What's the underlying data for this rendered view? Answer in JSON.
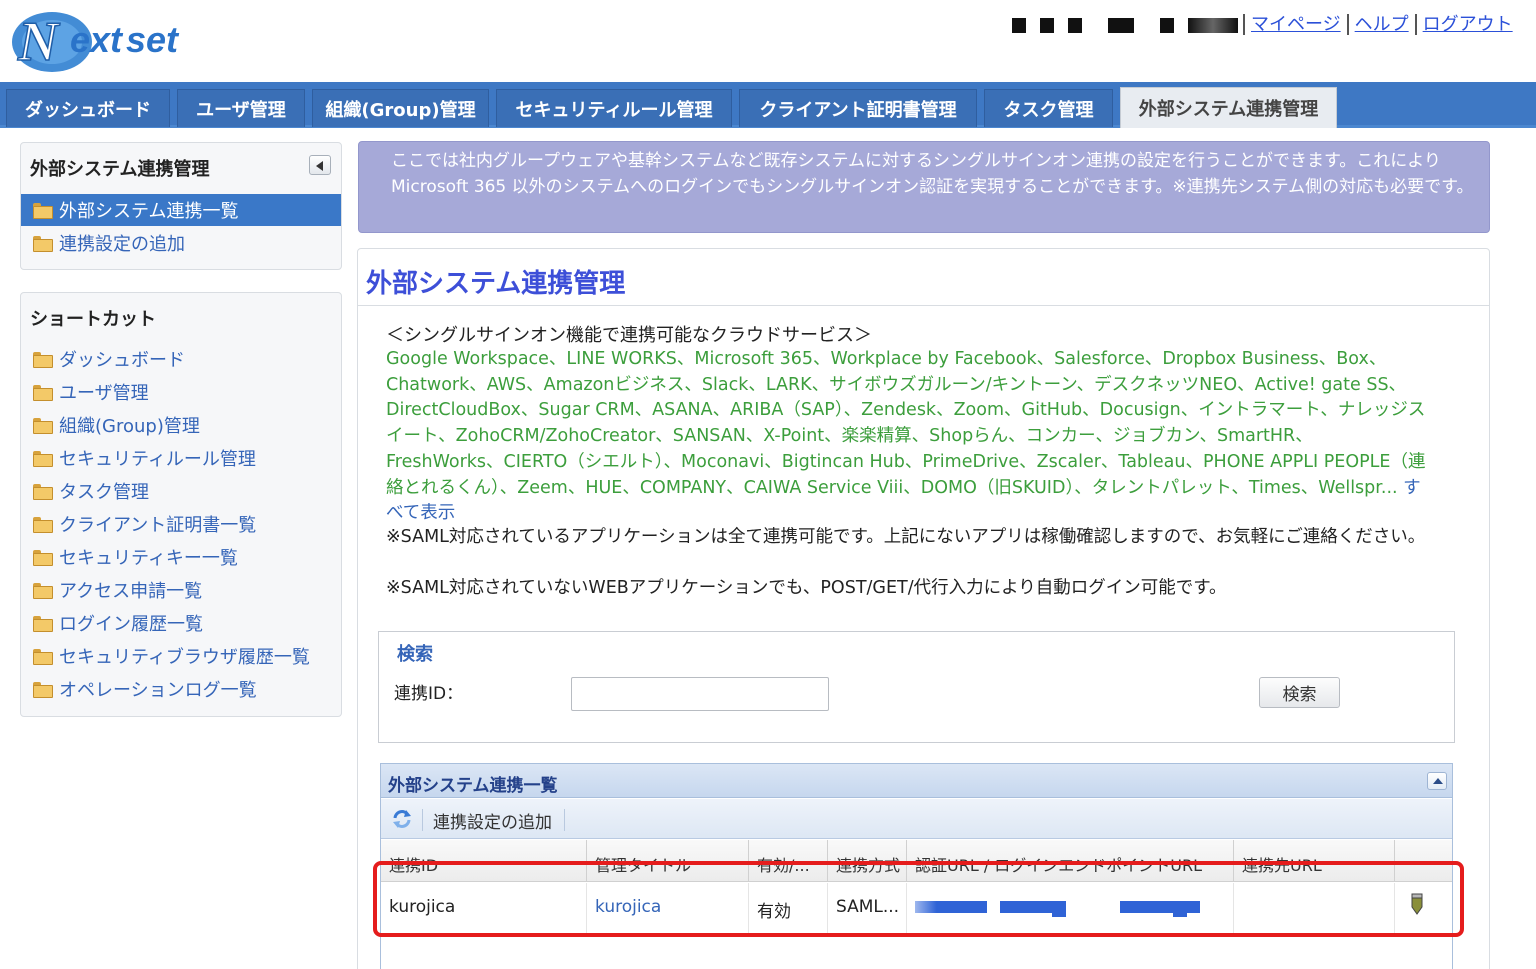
{
  "header": {
    "logo_text": "Nextset",
    "user_name_redacted": "■■■ ■■ ■ ■■■■",
    "links": [
      {
        "label": "マイページ"
      },
      {
        "label": "ヘルプ"
      },
      {
        "label": "ログアウト"
      }
    ]
  },
  "nav": {
    "tabs": [
      {
        "label": "ダッシュボード"
      },
      {
        "label": "ユーザ管理"
      },
      {
        "label": "組織(Group)管理"
      },
      {
        "label": "セキュリティルール管理"
      },
      {
        "label": "クライアント証明書管理"
      },
      {
        "label": "タスク管理"
      },
      {
        "label": "外部システム連携管理",
        "active": true
      }
    ]
  },
  "sidebar": {
    "section_title": "外部システム連携管理",
    "items": [
      {
        "label": "外部システム連携一覧",
        "selected": true
      },
      {
        "label": "連携設定の追加"
      }
    ],
    "shortcut_title": "ショートカット",
    "shortcuts": [
      {
        "label": "ダッシュボード"
      },
      {
        "label": "ユーザ管理"
      },
      {
        "label": "組織(Group)管理"
      },
      {
        "label": "セキュリティルール管理"
      },
      {
        "label": "タスク管理"
      },
      {
        "label": "クライアント証明書一覧"
      },
      {
        "label": "セキュリティキー一覧"
      },
      {
        "label": "アクセス申請一覧"
      },
      {
        "label": "ログイン履歴一覧"
      },
      {
        "label": "セキュリティブラウザ履歴一覧"
      },
      {
        "label": "オペレーションログ一覧"
      }
    ]
  },
  "info_banner": "ここでは社内グループウェアや基幹システムなど既存システムに対するシングルサインオン連携の設定を行うことができます。これによりMicrosoft 365 以外のシステムへのログインでもシングルサインオン認証を実現することができます。※連携先システム側の対応も必要です。",
  "main": {
    "title": "外部システム連携管理",
    "services_heading": "＜シングルサインオン機能で連携可能なクラウドサービス＞",
    "services_list": "Google Workspace、LINE WORKS、Microsoft 365、Workplace by Facebook、Salesforce、Dropbox Business、Box、Chatwork、AWS、Amazonビジネス、Slack、LARK、サイボウズガルーン/キントーン、デスクネッツNEO、Active! gate SS、DirectCloudBox、Sugar CRM、ASANA、ARIBA（SAP）、Zendesk、Zoom、GitHub、Docusign、イントラマート、ナレッジスイート、ZohoCRM/ZohoCreator、SANSAN、X-Point、楽楽精算、Shopらん、コンカー、ジョブカン、SmartHR、FreshWorks、CIERTO（シエルト）、Moconavi、Bigtincan Hub、PrimeDrive、Zscaler、Tableau、PHONE APPLI PEOPLE（連絡とれるくん）、Zeem、HUE、COMPANY、CAIWA Service Viii、DOMO（旧SKUID）、タレントパレット、Times、Wellspr...",
    "show_all": "すべて表示",
    "note1": "※SAML対応されているアプリケーションは全て連携可能です。上記にないアプリは稼働確認しますので、お気軽にご連絡ください。",
    "note2": "※SAML対応されていないWEBアプリケーションでも、POST/GET/代行入力により自動ログイン可能です。"
  },
  "search": {
    "title": "検索",
    "label": "連携ID：",
    "value": "",
    "button": "検索"
  },
  "grid": {
    "title": "外部システム連携一覧",
    "toolbar_add": "連携設定の追加",
    "columns": [
      "連携ID",
      "管理タイトル",
      "有効/...",
      "連携方式",
      "認証URL / ログインエンドポイントURL",
      "連携先URL",
      ""
    ],
    "rows": [
      {
        "id": "kurojica",
        "title": "kurojica",
        "enabled": "有効",
        "method": "SAML...",
        "auth_url": "[redacted]",
        "dest_url": ""
      }
    ]
  },
  "colors": {
    "nav_blue": "#3e78c4",
    "link_blue": "#3565b8",
    "service_green": "#3c9e3c",
    "banner_purple": "#a6a9d8",
    "highlight_red": "#e51c1c"
  }
}
